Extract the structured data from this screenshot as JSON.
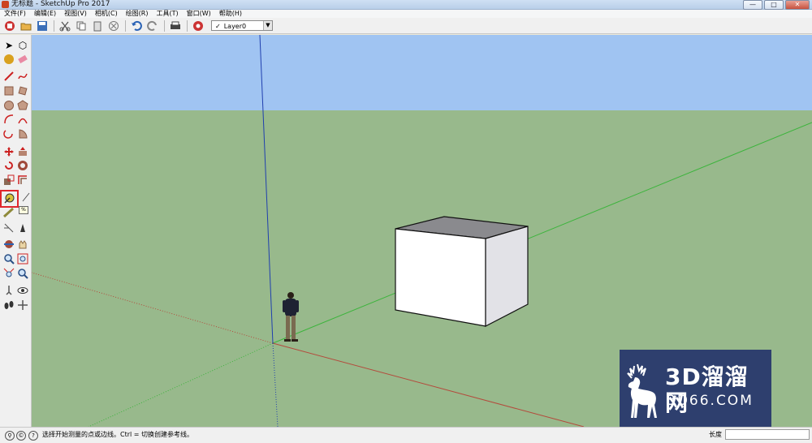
{
  "window": {
    "title": "无标题 - SketchUp Pro 2017",
    "controls": [
      "—",
      "□",
      "✕"
    ]
  },
  "menu": [
    "文件(F)",
    "编辑(E)",
    "视图(V)",
    "相机(C)",
    "绘图(R)",
    "工具(T)",
    "窗口(W)",
    "帮助(H)"
  ],
  "toolbar": {
    "layer_selected": "Layer0",
    "layer_check": "✓"
  },
  "sidebar": {
    "tooltip_hint": "%"
  },
  "status": {
    "hint": "选择开始测量的点或边线。Ctrl = 切换创建参考线。",
    "measure_label": "长度",
    "measure_value": ""
  },
  "watermark": {
    "line1": "3D溜溜网",
    "line2": "3D66.COM"
  },
  "colors": {
    "sky": "#9fc3f0",
    "ground": "#98b98c",
    "highlight": "#e0262c",
    "axis_red": "#b44a3c",
    "axis_green": "#3cb43c",
    "axis_blue": "#1f3fae",
    "watermark_bg": "#2e3f6e"
  }
}
